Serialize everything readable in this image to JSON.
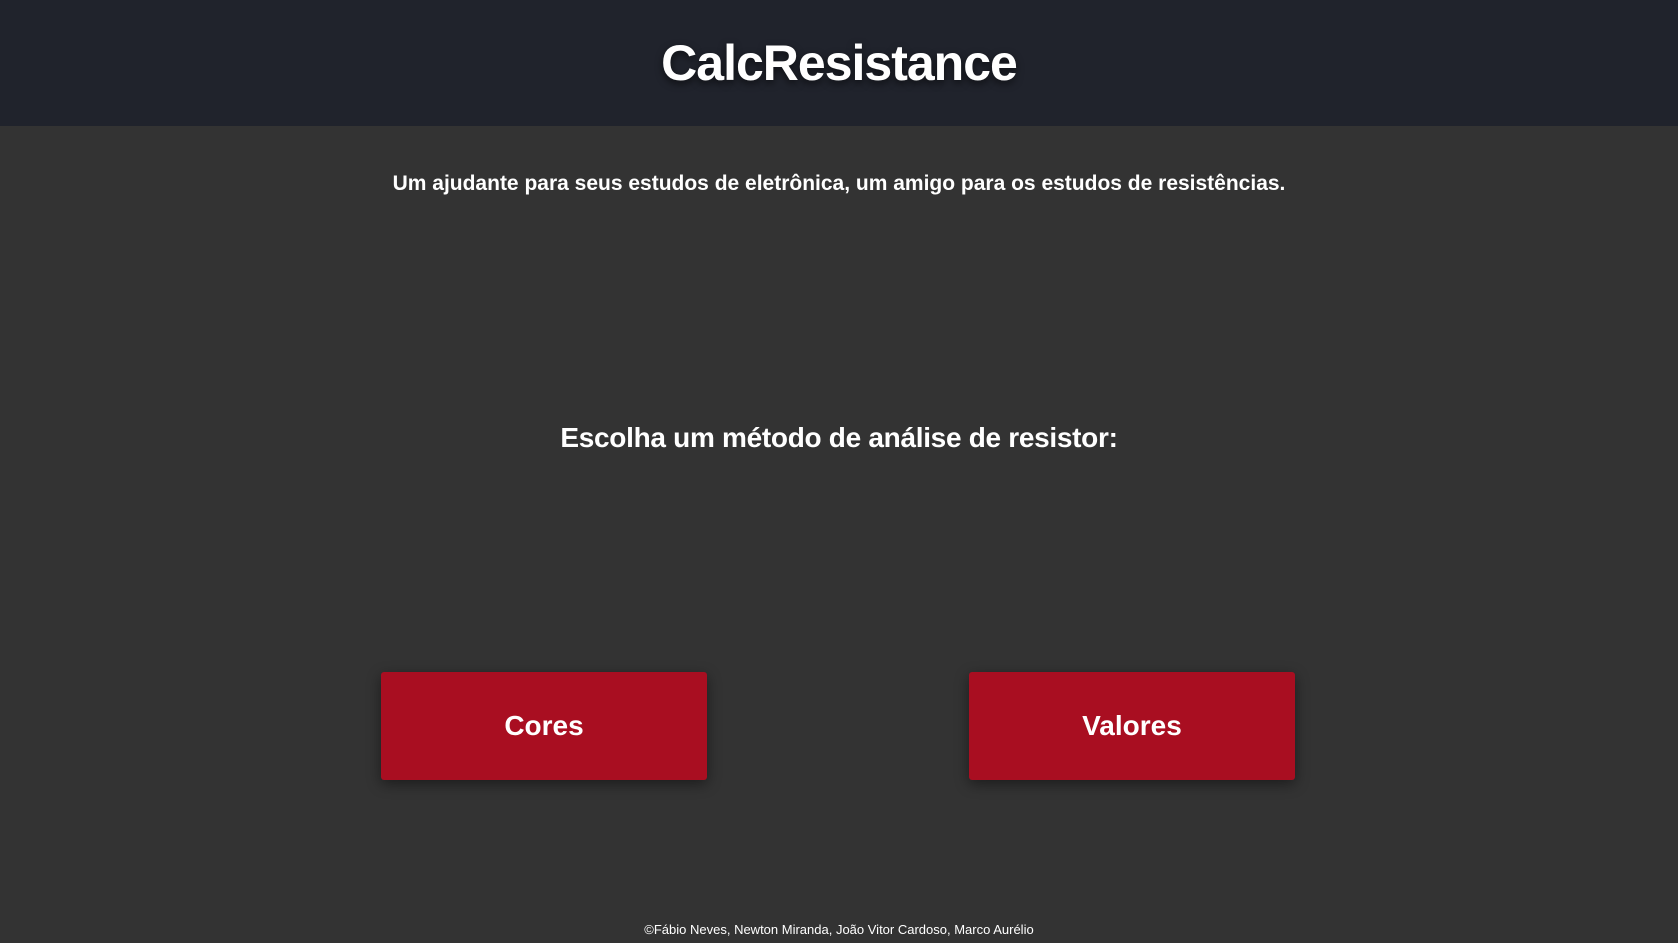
{
  "header": {
    "title": "CalcResistance"
  },
  "main": {
    "tagline": "Um ajudante para seus estudos de eletrônica, um amigo para os estudos de resistências.",
    "prompt": "Escolha um método de análise de resistor:",
    "buttons": [
      {
        "label": "Cores"
      },
      {
        "label": "Valores"
      }
    ]
  },
  "footer": {
    "credits": "©Fábio Neves, Newton Miranda, João Vitor Cardoso, Marco Aurélio"
  },
  "colors": {
    "header_background": "#20232c",
    "page_background": "#333333",
    "button_background": "#a90e21",
    "text": "#ffffff"
  }
}
